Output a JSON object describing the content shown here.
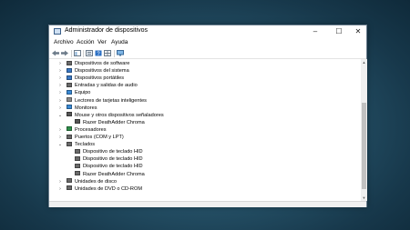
{
  "window": {
    "title": "Administrador de dispositivos",
    "minimize_glyph": "–",
    "maximize_glyph": "☐",
    "close_glyph": "✕"
  },
  "menu": [
    "Archivo",
    "Acción",
    "Ver",
    "Ayuda"
  ],
  "toolbar": [
    "back-arrow-icon",
    "forward-arrow-icon",
    "show-hide-tree-icon",
    "properties-icon",
    "help-icon",
    "view-toggle-icon",
    "scan-hardware-icon"
  ],
  "tree": [
    {
      "label": "Dispositivos de software",
      "level": 0,
      "expander": "›",
      "icon": "software-device-icon",
      "color": "#6a6a6a"
    },
    {
      "label": "Dispositivos del sistema",
      "level": 0,
      "expander": "›",
      "icon": "system-device-icon",
      "color": "#3a78c4"
    },
    {
      "label": "Dispositivos portátiles",
      "level": 0,
      "expander": "›",
      "icon": "portable-device-icon",
      "color": "#3a78c4"
    },
    {
      "label": "Entradas y salidas de audio",
      "level": 0,
      "expander": "›",
      "icon": "audio-icon",
      "color": "#6a6a6a"
    },
    {
      "label": "Equipo",
      "level": 0,
      "expander": "›",
      "icon": "computer-icon",
      "color": "#3a8ad6"
    },
    {
      "label": "Lectores de tarjetas inteligentes",
      "level": 0,
      "expander": "›",
      "icon": "smartcard-reader-icon",
      "color": "#8a8a8a"
    },
    {
      "label": "Monitores",
      "level": 0,
      "expander": "›",
      "icon": "monitor-icon",
      "color": "#3a8ad6"
    },
    {
      "label": "Mouse y otros dispositivos señaladores",
      "level": 0,
      "expander": "⌄",
      "icon": "mouse-icon",
      "color": "#555555"
    },
    {
      "label": "Razer DeathAdder Chroma",
      "level": 1,
      "expander": "",
      "icon": "mouse-icon",
      "color": "#555555"
    },
    {
      "label": "Procesadores",
      "level": 0,
      "expander": "›",
      "icon": "processor-icon",
      "color": "#2f8f4a"
    },
    {
      "label": "Puertos (COM y LPT)",
      "level": 0,
      "expander": "›",
      "icon": "port-icon",
      "color": "#6a6a6a"
    },
    {
      "label": "Teclados",
      "level": 0,
      "expander": "⌄",
      "icon": "keyboard-icon",
      "color": "#6a6a6a"
    },
    {
      "label": "Dispositivo de teclado HID",
      "level": 1,
      "expander": "",
      "icon": "keyboard-icon",
      "color": "#6a6a6a"
    },
    {
      "label": "Dispositivo de teclado HID",
      "level": 1,
      "expander": "",
      "icon": "keyboard-icon",
      "color": "#6a6a6a"
    },
    {
      "label": "Dispositivo de teclado HID",
      "level": 1,
      "expander": "",
      "icon": "keyboard-icon",
      "color": "#6a6a6a"
    },
    {
      "label": "Razer DeathAdder Chroma",
      "level": 1,
      "expander": "",
      "icon": "keyboard-icon",
      "color": "#6a6a6a"
    },
    {
      "label": "Unidades de disco",
      "level": 0,
      "expander": "›",
      "icon": "disk-drive-icon",
      "color": "#6a6a6a"
    },
    {
      "label": "Unidades de DVD o CD-ROM",
      "level": 0,
      "expander": "›",
      "icon": "dvd-drive-icon",
      "color": "#6a6a6a"
    }
  ],
  "scrollbar": {
    "up_glyph": "▲",
    "down_glyph": "▼",
    "position": 0.6
  }
}
